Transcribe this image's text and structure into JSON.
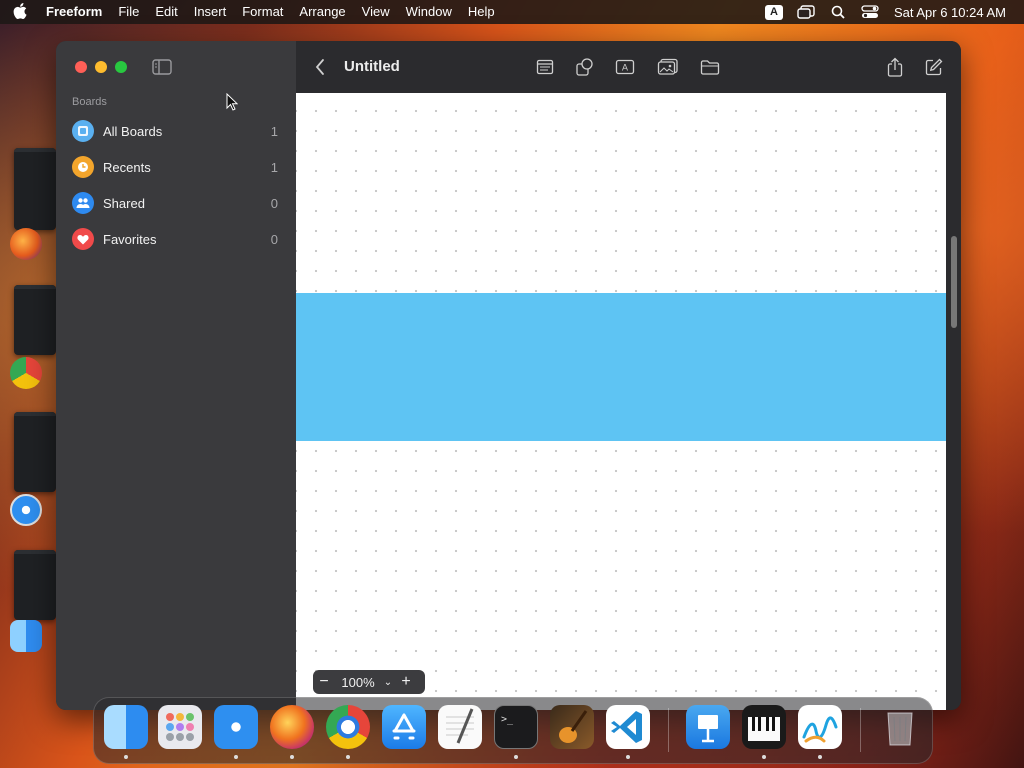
{
  "menubar": {
    "app": "Freeform",
    "items": [
      "File",
      "Edit",
      "Insert",
      "Format",
      "Arrange",
      "View",
      "Window",
      "Help"
    ],
    "input_indicator": "A",
    "clock": "Sat Apr 6  10:24 AM"
  },
  "window": {
    "title": "Untitled",
    "sidebar": {
      "heading": "Boards",
      "items": [
        {
          "label": "All Boards",
          "count": "1",
          "color": "#5ab0f0"
        },
        {
          "label": "Recents",
          "count": "1",
          "color": "#f3a52c"
        },
        {
          "label": "Shared",
          "count": "0",
          "color": "#2e8af0"
        },
        {
          "label": "Favorites",
          "count": "0",
          "color": "#f04a4a"
        }
      ]
    },
    "toolbar_icons": [
      "sticky-note-icon",
      "shapes-icon",
      "text-box-icon",
      "media-icon",
      "file-icon",
      "share-icon",
      "compose-icon"
    ],
    "zoom": {
      "value": "100%",
      "minus": "−",
      "plus": "+",
      "chevron": "⌄"
    }
  },
  "canvas": {
    "rect_color": "#5ec4f3"
  },
  "dock": {
    "apps": [
      "Finder",
      "Launchpad",
      "Safari",
      "Firefox",
      "Chrome",
      "App Store",
      "TextEdit",
      "Terminal",
      "GarageBand",
      "Visual Studio Code",
      "Keynote",
      "Piano",
      "Freeform",
      "Trash"
    ]
  }
}
